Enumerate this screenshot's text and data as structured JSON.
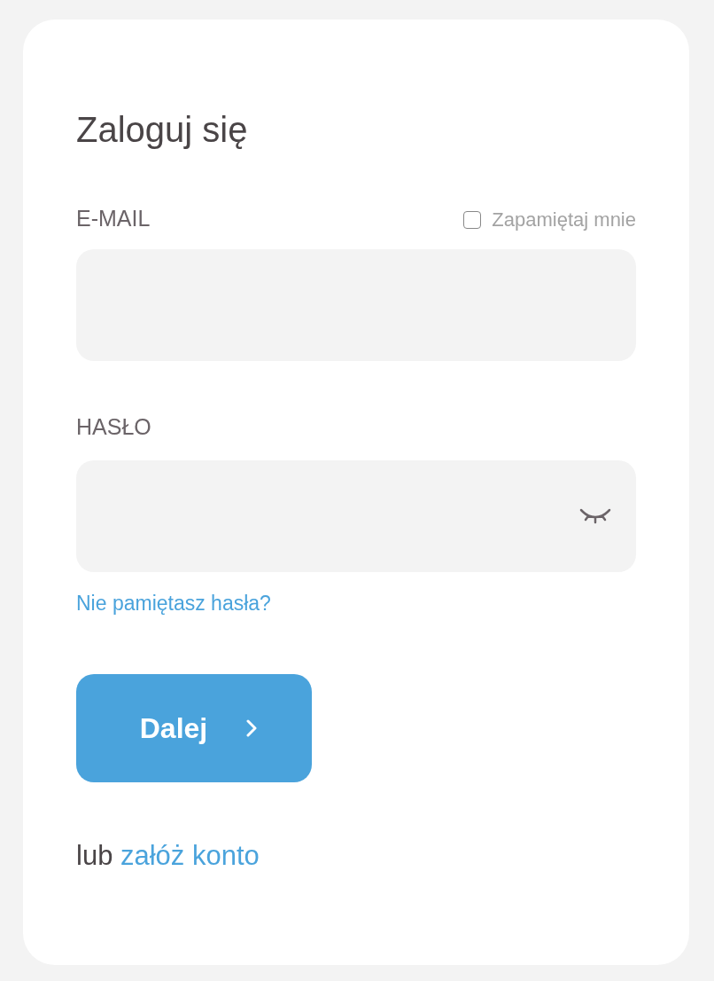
{
  "title": "Zaloguj się",
  "email": {
    "label": "E-MAIL"
  },
  "remember": {
    "label": "Zapamiętaj mnie",
    "checked": false
  },
  "password": {
    "label": "HASŁO",
    "visible": false
  },
  "forgot_link": "Nie pamiętasz hasła?",
  "submit": {
    "label": "Dalej"
  },
  "footer": {
    "text": "lub",
    "link": "załóż konto"
  }
}
